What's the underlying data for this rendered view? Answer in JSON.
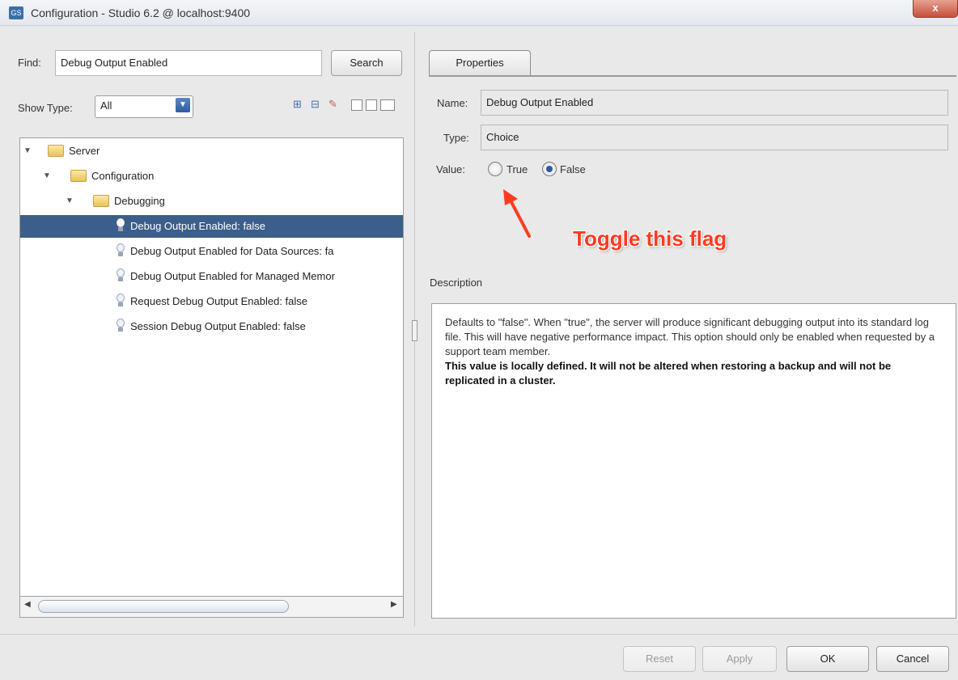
{
  "window": {
    "icon_text": "GS",
    "title": "Configuration - Studio 6.2 @ localhost:9400",
    "close_glyph": "x"
  },
  "left": {
    "find_label": "Find:",
    "find_value": "Debug Output Enabled",
    "search_button": "Search",
    "show_type_label": "Show Type:",
    "show_type_value": "All",
    "tree": [
      {
        "label": "Server",
        "level": 0,
        "kind": "folder",
        "expanded": true
      },
      {
        "label": "Configuration",
        "level": 1,
        "kind": "folder",
        "expanded": true
      },
      {
        "label": "Debugging",
        "level": 2,
        "kind": "folder",
        "expanded": true
      },
      {
        "label": "Debug Output Enabled: false",
        "level": 3,
        "kind": "setting",
        "selected": true
      },
      {
        "label": "Debug Output Enabled for Data Sources: fa",
        "level": 3,
        "kind": "setting"
      },
      {
        "label": "Debug Output Enabled for Managed Memor",
        "level": 3,
        "kind": "setting"
      },
      {
        "label": "Request Debug Output Enabled: false",
        "level": 3,
        "kind": "setting"
      },
      {
        "label": "Session Debug Output Enabled: false",
        "level": 3,
        "kind": "setting"
      }
    ]
  },
  "right": {
    "tab_label": "Properties",
    "name_label": "Name:",
    "name_value": "Debug Output Enabled",
    "type_label": "Type:",
    "type_value": "Choice",
    "value_label": "Value:",
    "option_true": "True",
    "option_false": "False",
    "selected_option": "False",
    "annotation": "Toggle this flag",
    "description_label": "Description",
    "description_text": "Defaults to \"false\". When \"true\", the server will produce significant debugging output into its standard log file. This will have negative performance impact. This option should only be enabled when requested by a support team member.",
    "description_bold": "This value is locally defined. It will not be altered when restoring a backup and will not be replicated in a cluster."
  },
  "footer": {
    "reset": "Reset",
    "apply": "Apply",
    "ok": "OK",
    "cancel": "Cancel"
  },
  "colors": {
    "selection": "#3c5e8a",
    "annotation": "#ff3b1f"
  }
}
